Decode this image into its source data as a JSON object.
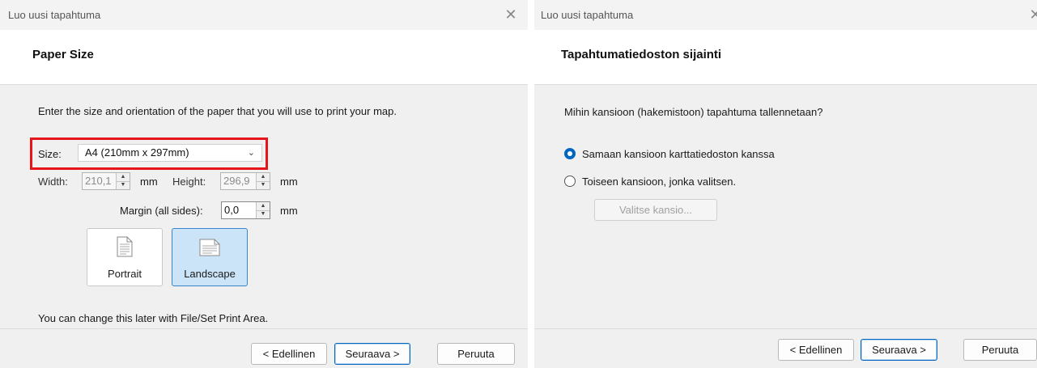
{
  "dialog_left": {
    "title": "Luo uusi tapahtuma",
    "close_glyph": "✕",
    "header_title": "Paper Size",
    "instruction": "Enter the size and orientation of the paper that you will use to print your map.",
    "size_label": "Size:",
    "size_value": "A4 (210mm x 297mm)",
    "width_label": "Width:",
    "width_value": "210,1",
    "width_unit": "mm",
    "height_label": "Height:",
    "height_value": "296,9",
    "height_unit": "mm",
    "margin_label": "Margin (all sides):",
    "margin_value": "0,0",
    "margin_unit": "mm",
    "orientation_portrait": "Portrait",
    "orientation_landscape": "Landscape",
    "orientation_selected": "Landscape",
    "note": "You can change this later with File/Set Print Area.",
    "buttons": {
      "back": "< Edellinen",
      "next": "Seuraava >",
      "cancel": "Peruuta"
    }
  },
  "dialog_right": {
    "title": "Luo uusi tapahtuma",
    "close_glyph": "✕",
    "header_title": "Tapahtumatiedoston sijainti",
    "question": "Mihin kansioon (hakemistoon) tapahtuma tallennetaan?",
    "option_same": "Samaan kansioon karttatiedoston kanssa",
    "option_other": "Toiseen kansioon, jonka valitsen.",
    "selected_option": "option_same",
    "choose_folder": "Valitse kansio...",
    "buttons": {
      "back": "< Edellinen",
      "next": "Seuraava >",
      "cancel": "Peruuta"
    }
  },
  "colors": {
    "highlight": "#e8141c",
    "accent": "#0067c0",
    "selected_tile": "#cce4f7"
  }
}
